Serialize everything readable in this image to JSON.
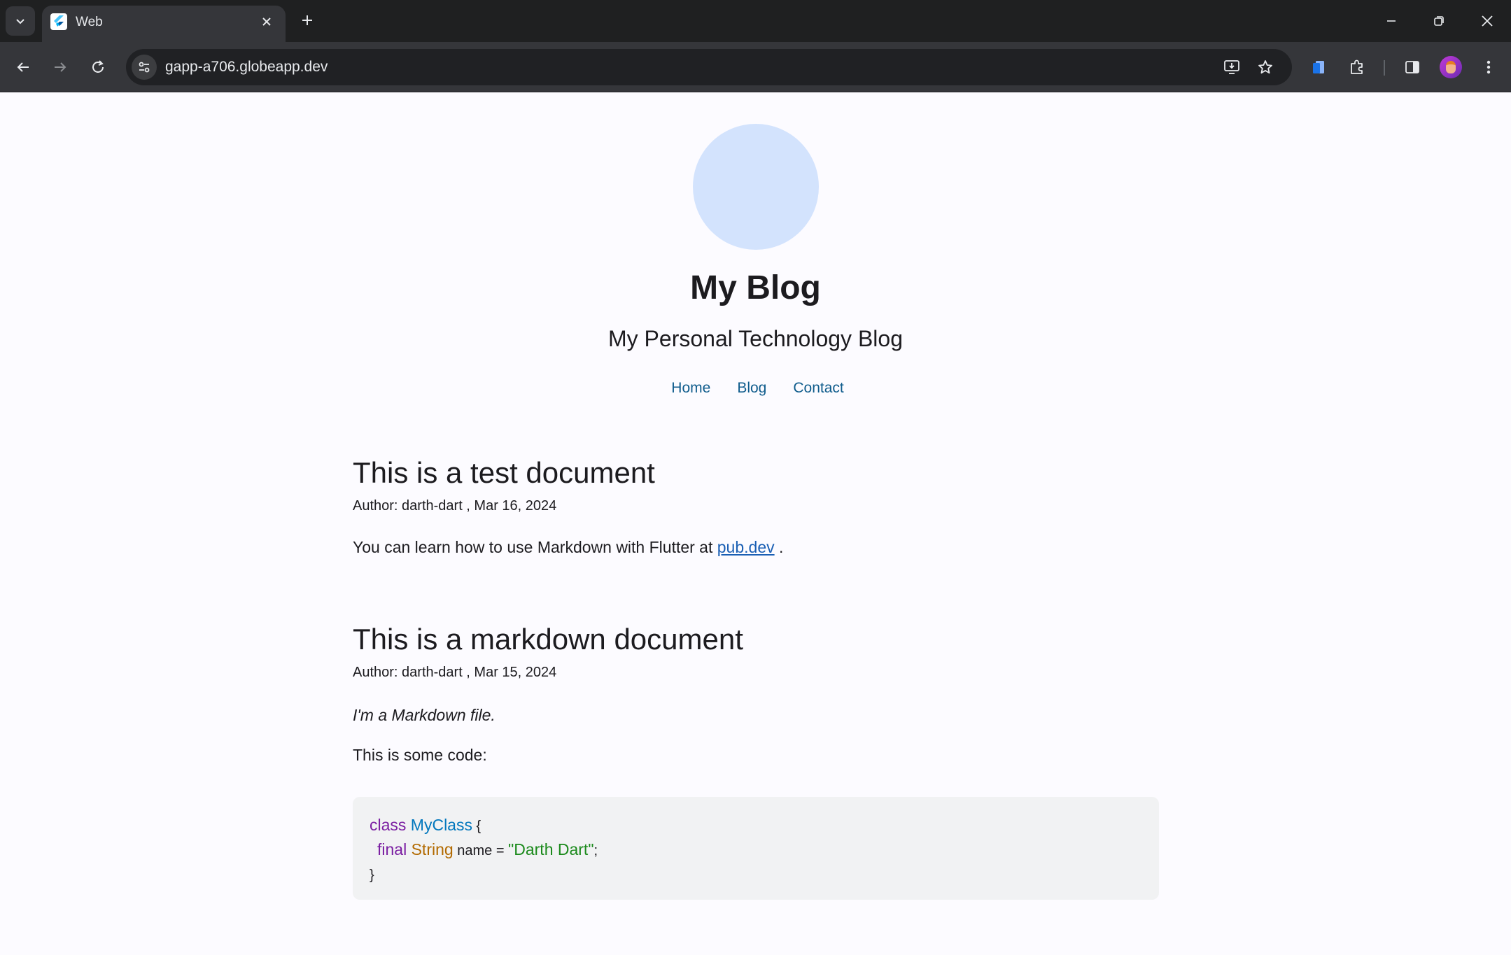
{
  "browser": {
    "tab_title": "Web",
    "url": "gapp-a706.globeapp.dev",
    "colors": {
      "tabbar": "#1f2021",
      "toolbar": "#35363a",
      "omnibox": "#202124"
    }
  },
  "site": {
    "title": "My Blog",
    "subtitle": "My Personal Technology Blog",
    "nav": [
      "Home",
      "Blog",
      "Contact"
    ],
    "hero_color": "#d3e3fd"
  },
  "posts": [
    {
      "title": "This is a test document",
      "meta": "Author: darth-dart , Mar 16, 2024",
      "body_prefix": "You can learn how to use Markdown with Flutter at ",
      "link_text": "pub.dev",
      "body_suffix": " ."
    },
    {
      "title": "This is a markdown document",
      "meta": "Author: darth-dart , Mar 15, 2024",
      "italic_line": "I'm a Markdown file.",
      "line": "This is some code:",
      "code": {
        "kw_class": "class",
        "class_name": "MyClass",
        "open_brace": " {",
        "kw_final": "final",
        "type": "String",
        "field": " name = ",
        "string": "\"Darth Dart\"",
        "semicolon": ";",
        "close_brace": "}"
      }
    }
  ]
}
